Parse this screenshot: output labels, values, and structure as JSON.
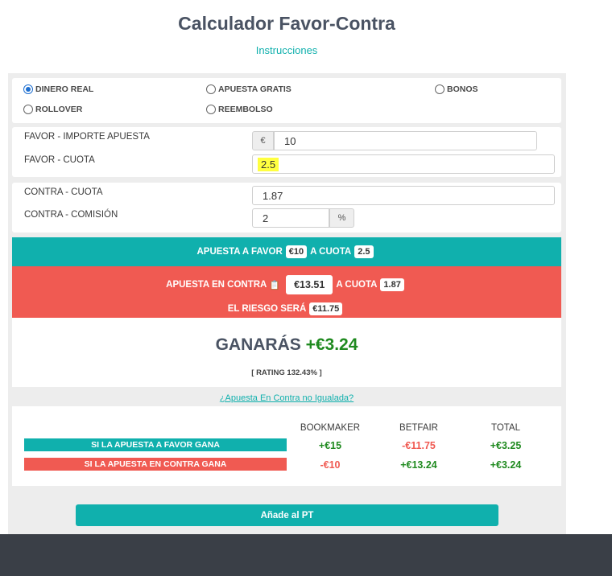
{
  "page": {
    "title": "Calculador Favor-Contra",
    "instructions_link": "Instrucciones"
  },
  "modes": {
    "selected": "DINERO REAL",
    "options": [
      "DINERO REAL",
      "APUESTA GRATIS",
      "BONOS",
      "ROLLOVER",
      "REEMBOLSO"
    ]
  },
  "favor": {
    "stake_label": "FAVOR - IMPORTE APUESTA",
    "currency_addon": "€",
    "stake_value": "10",
    "odds_label": "FAVOR - CUOTA",
    "odds_value": "2.5"
  },
  "contra": {
    "odds_label": "CONTRA - CUOTA",
    "odds_value": "1.87",
    "commission_label": "CONTRA - COMISIÓN",
    "commission_value": "2",
    "percent_addon": "%"
  },
  "summary": {
    "favor_prefix": "APUESTA A FAVOR",
    "favor_stake": "€10",
    "favor_mid": "A CUOTA",
    "favor_odds": "2.5",
    "contra_prefix": "APUESTA EN CONTRA",
    "contra_stake": "€13.51",
    "contra_mid": "A CUOTA",
    "contra_odds": "1.87",
    "risk_prefix": "EL RIESGO SERÁ",
    "risk_value": "€11.75"
  },
  "result": {
    "label": "GANARÁS",
    "value": "+€3.24",
    "rating": "[ RATING 132.43% ]"
  },
  "unmatched_link": "¿Apuesta En Contra no Igualada?",
  "table": {
    "headers": [
      "BOOKMAKER",
      "BETFAIR",
      "TOTAL"
    ],
    "rows": [
      {
        "label": "SI LA APUESTA A FAVOR GANA",
        "color": "#10b0ad",
        "bookmaker": "+€15",
        "betfair": "-€11.75",
        "total": "+€3.25"
      },
      {
        "label": "SI LA APUESTA EN CONTRA GANA",
        "color": "#f05a52",
        "bookmaker": "-€10",
        "betfair": "+€13.24",
        "total": "+€3.24"
      }
    ]
  },
  "add_button": "Añade al PT",
  "colors": {
    "accent": "#10b0ad",
    "danger": "#f05a52",
    "positive": "#1f8a1f",
    "highlight": "#ffff40"
  }
}
